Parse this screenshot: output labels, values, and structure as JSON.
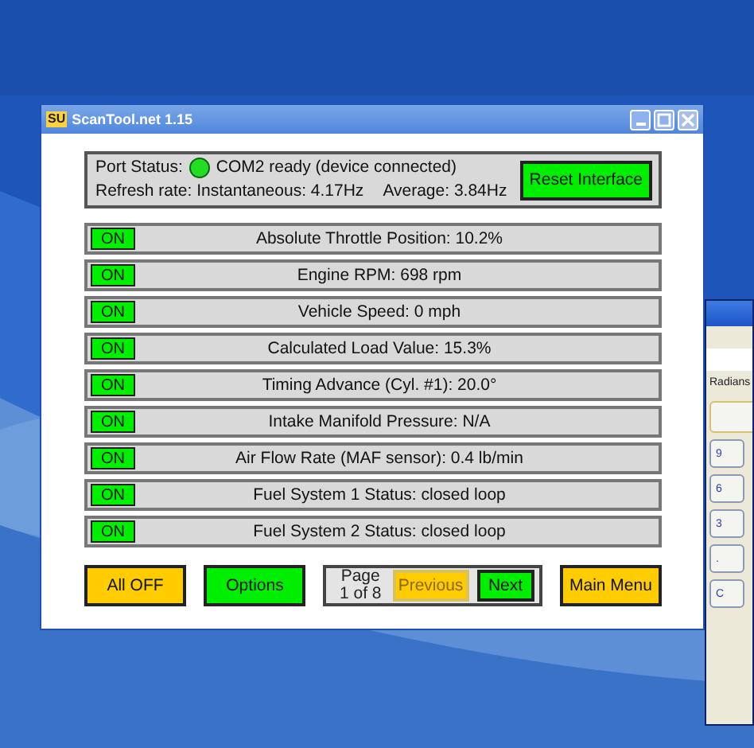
{
  "window": {
    "title": "ScanTool.net 1.15",
    "logo": "SU"
  },
  "status": {
    "port_label": "Port Status:",
    "connected": true,
    "port_text": "COM2 ready (device connected)",
    "refresh": "Refresh rate: Instantaneous: 4.17Hz",
    "average": "Average: 3.84Hz",
    "reset_button": "Reset Interface"
  },
  "sensors": [
    {
      "toggle": "ON",
      "on": true,
      "reading": "Absolute Throttle Position: 10.2%"
    },
    {
      "toggle": "ON",
      "on": true,
      "reading": "Engine RPM: 698 rpm"
    },
    {
      "toggle": "ON",
      "on": true,
      "reading": "Vehicle Speed: 0 mph"
    },
    {
      "toggle": "ON",
      "on": true,
      "reading": "Calculated Load Value: 15.3%"
    },
    {
      "toggle": "ON",
      "on": true,
      "reading": "Timing Advance (Cyl. #1): 20.0°"
    },
    {
      "toggle": "ON",
      "on": true,
      "reading": "Intake Manifold Pressure: N/A"
    },
    {
      "toggle": "ON",
      "on": true,
      "reading": "Air Flow Rate (MAF sensor): 0.4 lb/min"
    },
    {
      "toggle": "ON",
      "on": true,
      "reading": "Fuel System 1 Status: closed loop"
    },
    {
      "toggle": "ON",
      "on": true,
      "reading": "Fuel System 2 Status: closed loop"
    }
  ],
  "footer": {
    "all_off": {
      "label": "All OFF",
      "color": "#ffcc00"
    },
    "options": {
      "label": "Options",
      "color": "#00ee00"
    },
    "pager": {
      "page": "Page",
      "of": "1 of 8",
      "previous": {
        "label": "Previous",
        "disabled": true
      },
      "next": {
        "label": "Next",
        "disabled": false
      }
    },
    "main_menu": {
      "label": "Main Menu",
      "color": "#ffcc00"
    }
  },
  "calculator": {
    "mode": "Radians",
    "keys": [
      "9",
      "6",
      "3",
      ".",
      "C"
    ]
  }
}
